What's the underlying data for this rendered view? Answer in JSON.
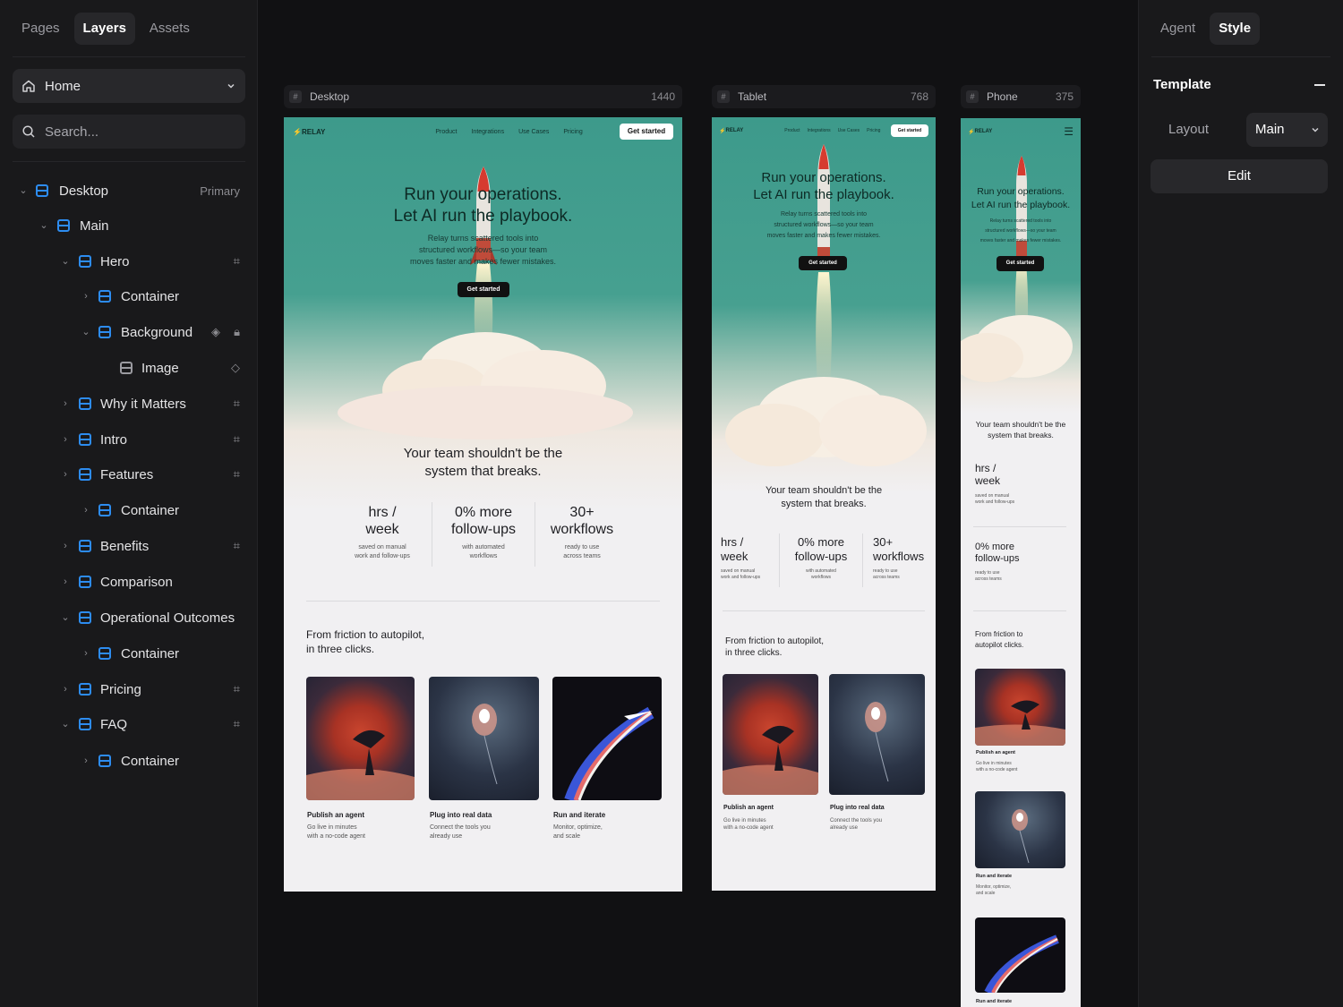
{
  "left_panel": {
    "tabs": [
      "Pages",
      "Layers",
      "Assets"
    ],
    "home_select": "Home",
    "search_placeholder": "Search...",
    "tree": [
      {
        "label": "Desktop",
        "badge": "Primary"
      },
      {
        "label": "Main"
      },
      {
        "label": "Hero"
      },
      {
        "label": "Container"
      },
      {
        "label": "Background"
      },
      {
        "label": "Image"
      },
      {
        "label": "Why it Matters"
      },
      {
        "label": "Intro"
      },
      {
        "label": "Features"
      },
      {
        "label": "Container"
      },
      {
        "label": "Benefits"
      },
      {
        "label": "Comparison"
      },
      {
        "label": "Operational Outcomes"
      },
      {
        "label": "Container"
      },
      {
        "label": "Pricing"
      },
      {
        "label": "FAQ"
      },
      {
        "label": "Container"
      }
    ]
  },
  "right_panel": {
    "tabs": [
      "Agent",
      "Style"
    ],
    "section_title": "Template",
    "layout_label": "Layout",
    "layout_value": "Main",
    "edit_label": "Edit"
  },
  "frames": {
    "desktop": {
      "name": "Desktop",
      "width": "1440"
    },
    "tablet": {
      "name": "Tablet",
      "width": "768"
    },
    "phone": {
      "name": "Phone",
      "width": "375"
    }
  },
  "site": {
    "logo": "RELAY",
    "nav_links": [
      "Product",
      "Integrations",
      "Use Cases",
      "Pricing"
    ],
    "cta": "Get started",
    "headline_1": "Run your operations.",
    "headline_2": "Let AI run the playbook.",
    "subline_1": "Relay turns scattered tools into",
    "subline_2": "structured workflows—so your team",
    "subline_3": "moves faster and makes fewer mistakes.",
    "hero_button": "Get started",
    "section_heading_1": "Your team shouldn't be the",
    "section_heading_2": "system that breaks.",
    "stats": [
      {
        "v1": "hrs /",
        "v2": "week",
        "d1": "saved on manual",
        "d2": "work and follow-ups"
      },
      {
        "v1": "0% more",
        "v2": "follow-ups",
        "d1": "with automated",
        "d2": "workflows"
      },
      {
        "v1": "30+",
        "v2": "workflows",
        "d1": "ready to use",
        "d2": "across teams"
      }
    ],
    "phone_stat2_d1": "ready to use",
    "phone_stat2_d2": "across teams",
    "friction_1": "From friction to autopilot,",
    "friction_2": "in three clicks.",
    "phone_friction_1": "From friction to",
    "phone_friction_2": "autopilot clicks.",
    "cards": [
      {
        "title": "Publish an agent",
        "d1": "Go live in minutes",
        "d2": "with a no-code agent"
      },
      {
        "title": "Plug into real data",
        "d1": "Connect the tools you",
        "d2": "already use"
      },
      {
        "title": "Run and iterate",
        "d1": "Monitor, optimize,",
        "d2": "and scale"
      }
    ]
  },
  "colors": {
    "panel_bg": "#19191b",
    "canvas_bg": "#111113",
    "accent_blue": "#2d8cf0",
    "hero_teal": "#3f9c8c"
  }
}
